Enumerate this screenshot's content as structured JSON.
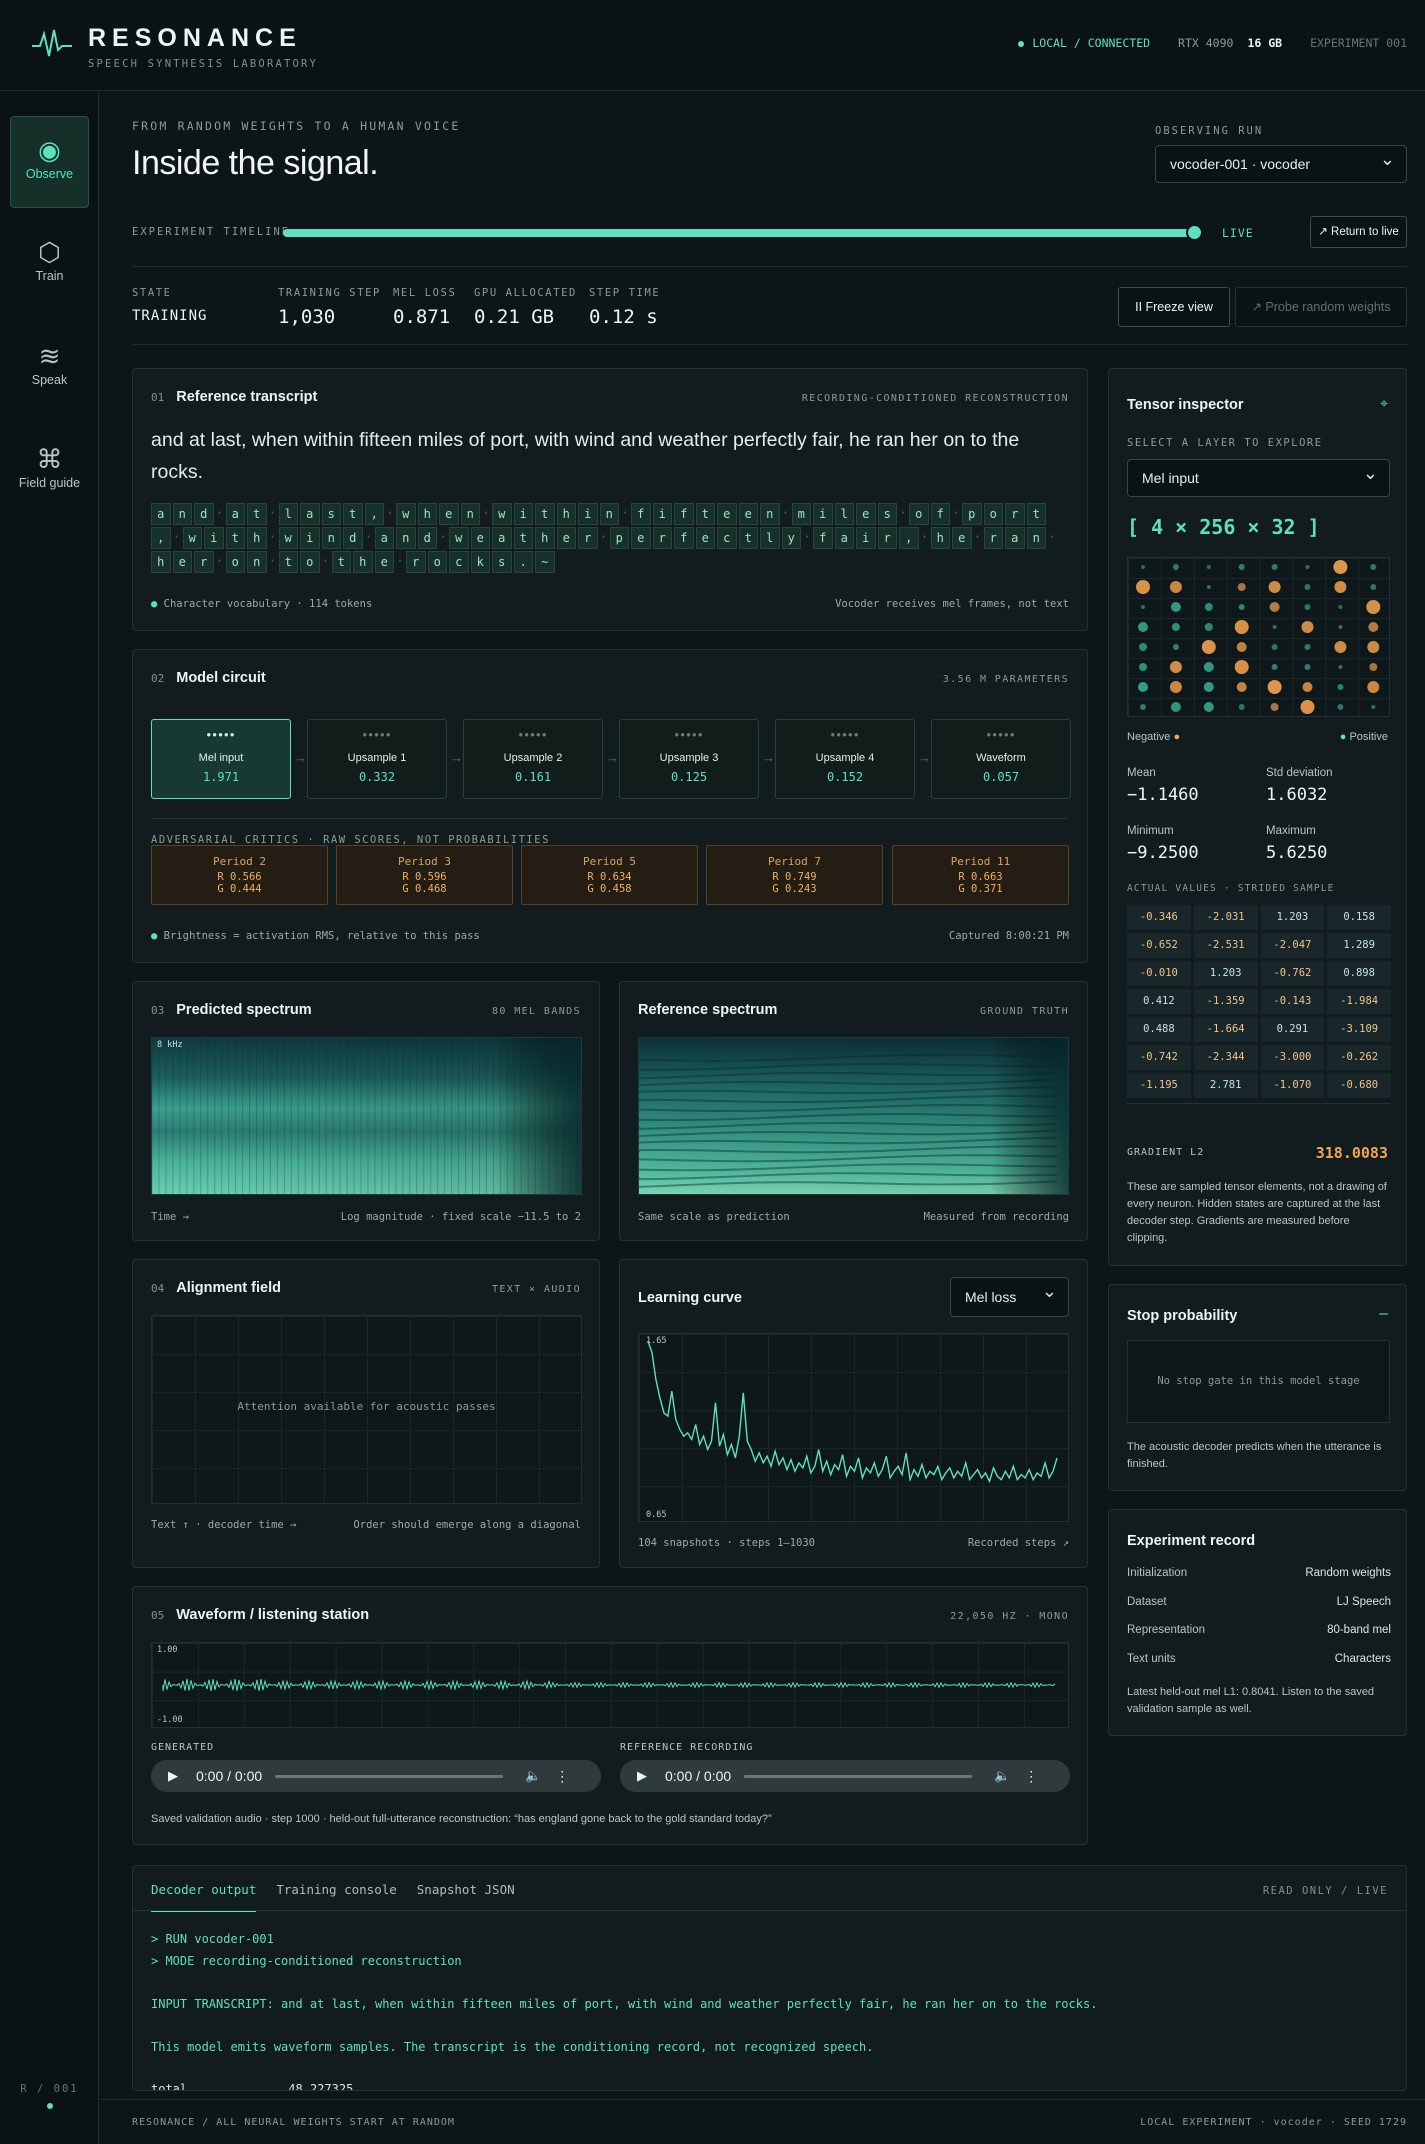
{
  "brand": {
    "name": "RESONANCE",
    "subtitle": "SPEECH SYNTHESIS LABORATORY"
  },
  "status": {
    "connection": "LOCAL / CONNECTED",
    "gpu": "RTX 4090",
    "memory": "16 GB",
    "experiment": "EXPERIMENT 001"
  },
  "nav": [
    {
      "label": "Observe",
      "icon": "target-icon"
    },
    {
      "label": "Train",
      "icon": "hexagon-icon"
    },
    {
      "label": "Speak",
      "icon": "waves-icon"
    },
    {
      "label": "Field guide",
      "icon": "command-icon"
    }
  ],
  "sidebar_version": "R / 001",
  "header": {
    "eyebrow": "FROM RANDOM WEIGHTS TO A HUMAN VOICE",
    "title": "Inside the signal.",
    "run_label": "OBSERVING RUN",
    "run_value": "vocoder-001 · vocoder"
  },
  "timeline": {
    "label": "EXPERIMENT TIMELINE",
    "live": "LIVE",
    "return": "↗ Return to live",
    "progress": 1.0
  },
  "stats": [
    {
      "k": "STATE",
      "v": "TRAINING"
    },
    {
      "k": "TRAINING STEP",
      "v": "1,030"
    },
    {
      "k": "MEL LOSS",
      "v": "0.871"
    },
    {
      "k": "GPU ALLOCATED",
      "v": "0.21 GB"
    },
    {
      "k": "STEP TIME",
      "v": "0.12 s"
    }
  ],
  "actions": {
    "freeze": "II Freeze view",
    "probe": "↗ Probe random weights"
  },
  "transcript_panel": {
    "num": "01",
    "title": "Reference transcript",
    "tag": "RECORDING-CONDITIONED RECONSTRUCTION",
    "text": "and at last, when within fifteen miles of port, with wind and weather perfectly fair, he ran her on to the rocks.",
    "chars": "and at last, when within fifteen miles of port, with wind and weather perfectly fair, he ran her on to the rocks.~",
    "foot_left": "Character vocabulary · 114 tokens",
    "foot_right": "Vocoder receives mel frames, not text"
  },
  "circuit": {
    "num": "02",
    "title": "Model circuit",
    "tag": "3.56 M PARAMETERS",
    "nodes": [
      {
        "name": "Mel input",
        "value": "1.971"
      },
      {
        "name": "Upsample 1",
        "value": "0.332"
      },
      {
        "name": "Upsample 2",
        "value": "0.161"
      },
      {
        "name": "Upsample 3",
        "value": "0.125"
      },
      {
        "name": "Upsample 4",
        "value": "0.152"
      },
      {
        "name": "Waveform",
        "value": "0.057"
      }
    ],
    "critics_label": "ADVERSARIAL CRITICS · RAW SCORES, NOT PROBABILITIES",
    "critics": [
      {
        "name": "Period 2",
        "r": "R 0.566",
        "g": "G 0.444"
      },
      {
        "name": "Period 3",
        "r": "R 0.596",
        "g": "G 0.468"
      },
      {
        "name": "Period 5",
        "r": "R 0.634",
        "g": "G 0.458"
      },
      {
        "name": "Period 7",
        "r": "R 0.749",
        "g": "G 0.243"
      },
      {
        "name": "Period 11",
        "r": "R 0.663",
        "g": "G 0.371"
      }
    ],
    "foot_left": "Brightness = activation RMS, relative to this pass",
    "foot_right": "Captured 8:00:21 PM"
  },
  "predicted": {
    "num": "03",
    "title": "Predicted spectrum",
    "tag": "80 MEL BANDS",
    "axis_top": "8 kHz",
    "foot_left": "Time →",
    "foot_right": "Log magnitude · fixed scale −11.5 to 2"
  },
  "reference": {
    "title": "Reference spectrum",
    "tag": "GROUND TRUTH",
    "foot_left": "Same scale as prediction",
    "foot_right": "Measured from recording"
  },
  "alignment": {
    "num": "04",
    "title": "Alignment field",
    "tag": "TEXT × AUDIO",
    "empty": "Attention available for acoustic passes",
    "foot_left": "Text ↑ · decoder time →",
    "foot_right": "Order should emerge along a diagonal"
  },
  "learning": {
    "title": "Learning curve",
    "select": "Mel loss",
    "foot_left": "104 snapshots · steps 1–1030",
    "foot_right": "Recorded steps ↗"
  },
  "chart_data": {
    "type": "line",
    "title": "Learning curve",
    "ylim": [
      0.65,
      1.65
    ],
    "y_tick_labels": [
      "1.65",
      "0.65"
    ],
    "series": [
      {
        "name": "Mel loss",
        "values": [
          1.65,
          1.58,
          1.42,
          1.31,
          1.22,
          1.2,
          1.35,
          1.18,
          1.12,
          1.08,
          1.1,
          1.06,
          1.15,
          1.03,
          1.08,
          1.0,
          1.05,
          1.28,
          1.02,
          1.09,
          0.97,
          1.03,
          0.95,
          1.08,
          1.34,
          1.05,
          1.0,
          0.93,
          0.98,
          0.92,
          0.96,
          0.9,
          0.99,
          0.91,
          0.95,
          0.88,
          0.94,
          0.87,
          0.92,
          0.89,
          0.96,
          0.86,
          0.9,
          1.0,
          0.87,
          0.93,
          0.85,
          0.91,
          0.88,
          0.97,
          0.84,
          0.9,
          0.87,
          0.95,
          0.83,
          0.89,
          0.86,
          0.92,
          0.84,
          0.88,
          0.96,
          0.83,
          0.87,
          0.9,
          0.85,
          0.98,
          0.82,
          0.88,
          0.84,
          0.91,
          0.83,
          0.87,
          0.85,
          0.9,
          0.82,
          0.86,
          0.89,
          0.83,
          0.87,
          0.84,
          0.92,
          0.82,
          0.85,
          0.88,
          0.83,
          0.86,
          0.81,
          0.89,
          0.84,
          0.82,
          0.87,
          0.83,
          0.9,
          0.82,
          0.85,
          0.83,
          0.88,
          0.82,
          0.86,
          0.84,
          0.92,
          0.83,
          0.87,
          0.95
        ]
      }
    ]
  },
  "waveform": {
    "num": "05",
    "title": "Waveform / listening station",
    "tag": "22,050 HZ · MONO",
    "y_top": "1.00",
    "y_bottom": "-1.00",
    "generated": "GENERATED",
    "reference": "REFERENCE RECORDING",
    "time": "0:00 / 0:00",
    "caption": "Saved validation audio · step 1000 · held-out full-utterance reconstruction: “has england gone back to the gold standard today?”"
  },
  "inspector": {
    "title": "Tensor inspector",
    "layer_label": "SELECT A LAYER TO EXPLORE",
    "layer": "Mel input",
    "shape": "[ 4 × 256 × 32 ]",
    "negative": "Negative",
    "positive": "Positive",
    "mean_k": "Mean",
    "mean_v": "−1.1460",
    "std_k": "Std deviation",
    "std_v": "1.6032",
    "min_k": "Minimum",
    "min_v": "−9.2500",
    "max_k": "Maximum",
    "max_v": "5.6250",
    "values_label": "ACTUAL VALUES · STRIDED SAMPLE",
    "values": [
      "-0.346",
      "-2.031",
      "1.203",
      "0.158",
      "-0.652",
      "-2.531",
      "-2.047",
      "1.289",
      "-0.010",
      "1.203",
      "-0.762",
      "0.898",
      "0.412",
      "-1.359",
      "-0.143",
      "-1.984",
      "0.488",
      "-1.664",
      "0.291",
      "-3.109",
      "-0.742",
      "-2.344",
      "-3.000",
      "-0.262",
      "-1.195",
      "2.781",
      "-1.070",
      "-0.680"
    ],
    "grad_k": "GRADIENT L2",
    "grad_v": "318.0083",
    "note": "These are sampled tensor elements, not a drawing of every neuron. Hidden states are captured at the last decoder step. Gradients are measured before clipping."
  },
  "stop": {
    "title": "Stop probability",
    "empty": "No stop gate in this model stage",
    "note": "The acoustic decoder predicts when the utterance is finished."
  },
  "record": {
    "title": "Experiment record",
    "rows": [
      {
        "k": "Initialization",
        "v": "Random weights"
      },
      {
        "k": "Dataset",
        "v": "LJ Speech"
      },
      {
        "k": "Representation",
        "v": "80-band mel"
      },
      {
        "k": "Text units",
        "v": "Characters"
      }
    ],
    "note": "Latest held-out mel L1: 0.8041. Listen to the saved validation sample as well."
  },
  "console": {
    "tabs": [
      "Decoder output",
      "Training console",
      "Snapshot JSON"
    ],
    "tag": "READ ONLY / LIVE",
    "lines": [
      "> RUN vocoder-001",
      "> MODE recording-conditioned reconstruction",
      "INPUT TRANSCRIPT: and at last, when within fifteen miles of port, with wind and weather perfectly fair, he ran her on to the rocks.",
      "This model emits waveform samples. The transcript is the conditioning record, not recognized speech.",
      "total              48,227325"
    ]
  },
  "footer": {
    "left": "RESONANCE  /  ALL NEURAL WEIGHTS START AT RANDOM",
    "right": "LOCAL EXPERIMENT · vocoder · SEED 1729"
  }
}
